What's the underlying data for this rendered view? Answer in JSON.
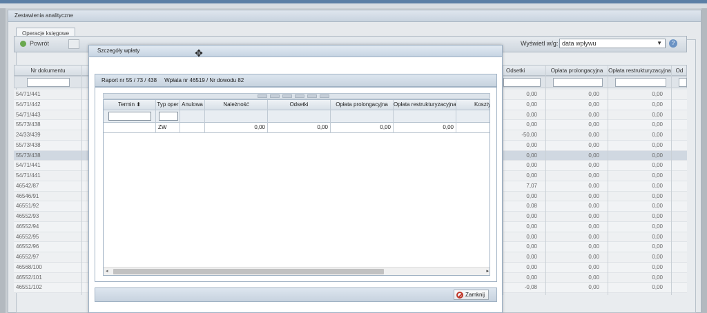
{
  "panel": {
    "title": "Zestawienia analityczne"
  },
  "tabs": [
    {
      "label": "Operacje księgowe"
    }
  ],
  "toolbar": {
    "back_label": "Powrót",
    "display_label": "Wyświetl w/g:",
    "display_value": "data wpływu",
    "help_label": "?"
  },
  "bg_grid": {
    "headers": {
      "doc": "Nr dokumentu",
      "ods": "Odsetki",
      "pro": "Opłata prolongacyjna",
      "res": "Opłata restrukturyzacyjna",
      "extra": "Od"
    },
    "rows": [
      {
        "doc": "54/71/441",
        "ods": "0,00",
        "pro": "0,00",
        "res": "0,00"
      },
      {
        "doc": "54/71/442",
        "ods": "0,00",
        "pro": "0,00",
        "res": "0,00"
      },
      {
        "doc": "54/71/443",
        "ods": "0,00",
        "pro": "0,00",
        "res": "0,00"
      },
      {
        "doc": "55/73/438",
        "ods": "0,00",
        "pro": "0,00",
        "res": "0,00"
      },
      {
        "doc": "24/33/439",
        "ods": "-50,00",
        "pro": "0,00",
        "res": "0,00"
      },
      {
        "doc": "55/73/438",
        "ods": "0,00",
        "pro": "0,00",
        "res": "0,00"
      },
      {
        "doc": "55/73/438",
        "ods": "0,00",
        "pro": "0,00",
        "res": "0,00"
      },
      {
        "doc": "54/71/441",
        "ods": "0,00",
        "pro": "0,00",
        "res": "0,00"
      },
      {
        "doc": "54/71/441",
        "ods": "0,00",
        "pro": "0,00",
        "res": "0,00"
      },
      {
        "doc": "46542/87",
        "ods": "7,07",
        "pro": "0,00",
        "res": "0,00"
      },
      {
        "doc": "46546/91",
        "ods": "0,00",
        "pro": "0,00",
        "res": "0,00"
      },
      {
        "doc": "46551/92",
        "ods": "0,08",
        "pro": "0,00",
        "res": "0,00"
      },
      {
        "doc": "46552/93",
        "ods": "0,00",
        "pro": "0,00",
        "res": "0,00"
      },
      {
        "doc": "46552/94",
        "ods": "0,00",
        "pro": "0,00",
        "res": "0,00"
      },
      {
        "doc": "46552/95",
        "ods": "0,00",
        "pro": "0,00",
        "res": "0,00"
      },
      {
        "doc": "46552/96",
        "ods": "0,00",
        "pro": "0,00",
        "res": "0,00"
      },
      {
        "doc": "46552/97",
        "ods": "0,00",
        "pro": "0,00",
        "res": "0,00"
      },
      {
        "doc": "46568/100",
        "ods": "0,00",
        "pro": "0,00",
        "res": "0,00"
      },
      {
        "doc": "46552/101",
        "ods": "0,00",
        "pro": "0,00",
        "res": "0,00"
      },
      {
        "doc": "46551/102",
        "ods": "-0,08",
        "pro": "0,00",
        "res": "0,00"
      }
    ]
  },
  "modal": {
    "title": "Szczegóły wpłaty",
    "report": "Raport nr 55 / 73 / 438",
    "payment": "Wpłata nr 46519 / Nr dowodu 82",
    "columns": {
      "termin": "Termin",
      "typ": "Typ oper",
      "anul": "Anulowa",
      "nal": "Należność",
      "ods": "Odsetki",
      "pro": "Opłata prolongacyjna",
      "res": "Opłata restrukturyzacyjna",
      "kosz": "Koszty"
    },
    "row": {
      "termin": "",
      "typ": "ZW",
      "anul": "",
      "nal": "0,00",
      "ods": "0,00",
      "pro": "0,00",
      "res": "0,00",
      "kosz": ""
    },
    "close_label": "Zamknij"
  }
}
